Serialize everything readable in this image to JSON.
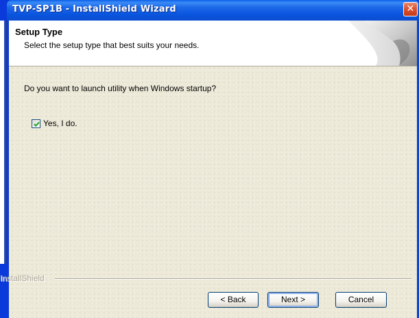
{
  "window": {
    "title": "TVP-SP1B - InstallShield Wizard",
    "close_glyph": "✕"
  },
  "header": {
    "title": "Setup Type",
    "subtitle": "Select the setup type that best suits your needs."
  },
  "body": {
    "question": "Do you want to launch utility when Windows startup?",
    "checkbox": {
      "label": "Yes, I do.",
      "checked": true
    }
  },
  "footer": {
    "brand": "InstallShield",
    "buttons": {
      "back": "< Back",
      "next": "Next >",
      "cancel": "Cancel"
    }
  },
  "colors": {
    "titlebar": "#0a55df",
    "dialog_bg": "#ece9d8",
    "close_button": "#db5432",
    "check_mark": "#21a121"
  },
  "icons": {
    "close": "close-icon",
    "check": "checkmark-icon",
    "header_art": "page-curl-graphic"
  }
}
